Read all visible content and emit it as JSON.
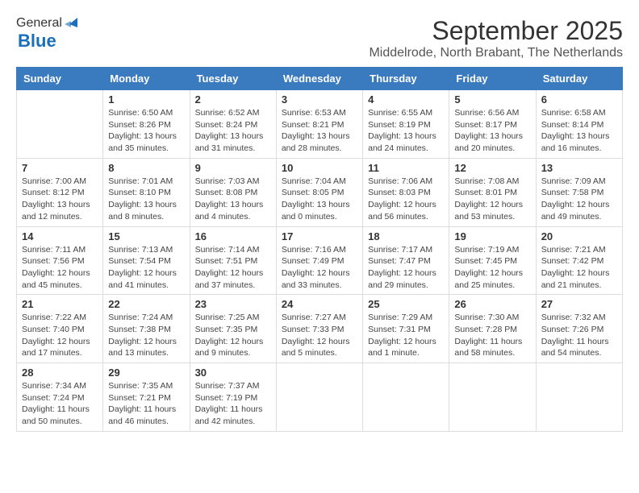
{
  "header": {
    "logo_general": "General",
    "logo_blue": "Blue",
    "title": "September 2025",
    "subtitle": "Middelrode, North Brabant, The Netherlands"
  },
  "calendar": {
    "days_of_week": [
      "Sunday",
      "Monday",
      "Tuesday",
      "Wednesday",
      "Thursday",
      "Friday",
      "Saturday"
    ],
    "weeks": [
      [
        {
          "day": "",
          "info": ""
        },
        {
          "day": "1",
          "info": "Sunrise: 6:50 AM\nSunset: 8:26 PM\nDaylight: 13 hours and 35 minutes."
        },
        {
          "day": "2",
          "info": "Sunrise: 6:52 AM\nSunset: 8:24 PM\nDaylight: 13 hours and 31 minutes."
        },
        {
          "day": "3",
          "info": "Sunrise: 6:53 AM\nSunset: 8:21 PM\nDaylight: 13 hours and 28 minutes."
        },
        {
          "day": "4",
          "info": "Sunrise: 6:55 AM\nSunset: 8:19 PM\nDaylight: 13 hours and 24 minutes."
        },
        {
          "day": "5",
          "info": "Sunrise: 6:56 AM\nSunset: 8:17 PM\nDaylight: 13 hours and 20 minutes."
        },
        {
          "day": "6",
          "info": "Sunrise: 6:58 AM\nSunset: 8:14 PM\nDaylight: 13 hours and 16 minutes."
        }
      ],
      [
        {
          "day": "7",
          "info": "Sunrise: 7:00 AM\nSunset: 8:12 PM\nDaylight: 13 hours and 12 minutes."
        },
        {
          "day": "8",
          "info": "Sunrise: 7:01 AM\nSunset: 8:10 PM\nDaylight: 13 hours and 8 minutes."
        },
        {
          "day": "9",
          "info": "Sunrise: 7:03 AM\nSunset: 8:08 PM\nDaylight: 13 hours and 4 minutes."
        },
        {
          "day": "10",
          "info": "Sunrise: 7:04 AM\nSunset: 8:05 PM\nDaylight: 13 hours and 0 minutes."
        },
        {
          "day": "11",
          "info": "Sunrise: 7:06 AM\nSunset: 8:03 PM\nDaylight: 12 hours and 56 minutes."
        },
        {
          "day": "12",
          "info": "Sunrise: 7:08 AM\nSunset: 8:01 PM\nDaylight: 12 hours and 53 minutes."
        },
        {
          "day": "13",
          "info": "Sunrise: 7:09 AM\nSunset: 7:58 PM\nDaylight: 12 hours and 49 minutes."
        }
      ],
      [
        {
          "day": "14",
          "info": "Sunrise: 7:11 AM\nSunset: 7:56 PM\nDaylight: 12 hours and 45 minutes."
        },
        {
          "day": "15",
          "info": "Sunrise: 7:13 AM\nSunset: 7:54 PM\nDaylight: 12 hours and 41 minutes."
        },
        {
          "day": "16",
          "info": "Sunrise: 7:14 AM\nSunset: 7:51 PM\nDaylight: 12 hours and 37 minutes."
        },
        {
          "day": "17",
          "info": "Sunrise: 7:16 AM\nSunset: 7:49 PM\nDaylight: 12 hours and 33 minutes."
        },
        {
          "day": "18",
          "info": "Sunrise: 7:17 AM\nSunset: 7:47 PM\nDaylight: 12 hours and 29 minutes."
        },
        {
          "day": "19",
          "info": "Sunrise: 7:19 AM\nSunset: 7:45 PM\nDaylight: 12 hours and 25 minutes."
        },
        {
          "day": "20",
          "info": "Sunrise: 7:21 AM\nSunset: 7:42 PM\nDaylight: 12 hours and 21 minutes."
        }
      ],
      [
        {
          "day": "21",
          "info": "Sunrise: 7:22 AM\nSunset: 7:40 PM\nDaylight: 12 hours and 17 minutes."
        },
        {
          "day": "22",
          "info": "Sunrise: 7:24 AM\nSunset: 7:38 PM\nDaylight: 12 hours and 13 minutes."
        },
        {
          "day": "23",
          "info": "Sunrise: 7:25 AM\nSunset: 7:35 PM\nDaylight: 12 hours and 9 minutes."
        },
        {
          "day": "24",
          "info": "Sunrise: 7:27 AM\nSunset: 7:33 PM\nDaylight: 12 hours and 5 minutes."
        },
        {
          "day": "25",
          "info": "Sunrise: 7:29 AM\nSunset: 7:31 PM\nDaylight: 12 hours and 1 minute."
        },
        {
          "day": "26",
          "info": "Sunrise: 7:30 AM\nSunset: 7:28 PM\nDaylight: 11 hours and 58 minutes."
        },
        {
          "day": "27",
          "info": "Sunrise: 7:32 AM\nSunset: 7:26 PM\nDaylight: 11 hours and 54 minutes."
        }
      ],
      [
        {
          "day": "28",
          "info": "Sunrise: 7:34 AM\nSunset: 7:24 PM\nDaylight: 11 hours and 50 minutes."
        },
        {
          "day": "29",
          "info": "Sunrise: 7:35 AM\nSunset: 7:21 PM\nDaylight: 11 hours and 46 minutes."
        },
        {
          "day": "30",
          "info": "Sunrise: 7:37 AM\nSunset: 7:19 PM\nDaylight: 11 hours and 42 minutes."
        },
        {
          "day": "",
          "info": ""
        },
        {
          "day": "",
          "info": ""
        },
        {
          "day": "",
          "info": ""
        },
        {
          "day": "",
          "info": ""
        }
      ]
    ]
  }
}
